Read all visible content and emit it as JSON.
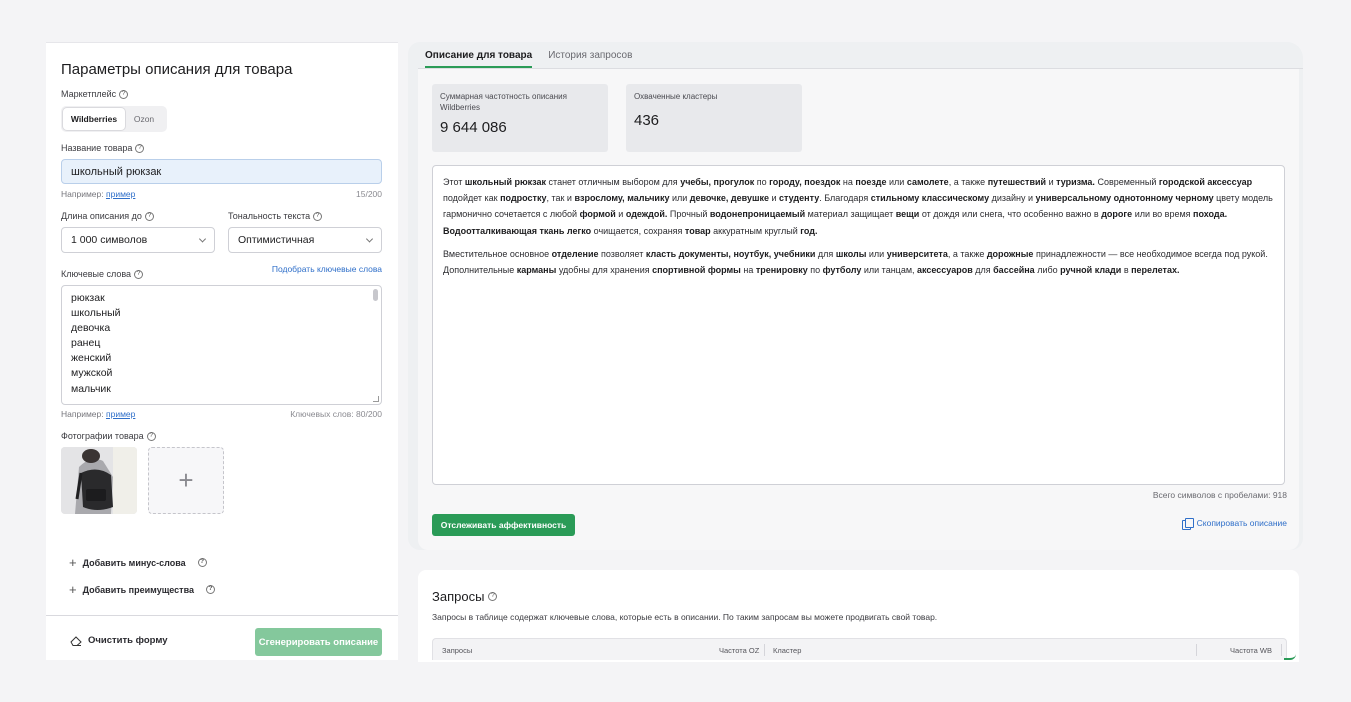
{
  "left": {
    "title": "Параметры описания для товара",
    "marketplace_label": "Маркетплейс",
    "marketplaces": [
      "Wildberries",
      "Ozon"
    ],
    "product_name_label": "Название товара",
    "product_name_value": "школьный рюкзак",
    "hint_prefix": "Например:",
    "hint_link": "пример",
    "product_name_counter": "15/200",
    "length_label": "Длина описания до",
    "length_value": "1 000 символов",
    "tone_label": "Тональность текста",
    "tone_value": "Оптимистичная",
    "keywords_label": "Ключевые слова",
    "pick_keywords": "Подобрать ключевые слова",
    "keywords": [
      "рюкзак",
      "школьный",
      "девочка",
      "ранец",
      "женский",
      "мужской",
      "мальчик"
    ],
    "keywords_counter": "Ключевых слов: 80/200",
    "photos_label": "Фотографии товара",
    "add_minus_words": "Добавить минус-слова",
    "add_advantages": "Добавить преимущества",
    "clear_form": "Очистить форму",
    "generate": "Сгенерировать описание"
  },
  "right": {
    "tabs": [
      "Описание для товара",
      "История запросов"
    ],
    "stats": [
      {
        "label": "Суммарная частотность описания Wildberries",
        "value": "9 644 086"
      },
      {
        "label": "Охваченные кластеры",
        "value": "436"
      }
    ],
    "total_chars": "Всего символов с пробелами: 918",
    "track_button": "Отслеживать аффективность",
    "copy_link": "Скопировать описание"
  },
  "queries": {
    "title": "Запросы",
    "subtitle": "Запросы в таблице содержат ключевые слова, которые есть в описании. По таким запросам вы можете продвигать свой товар.",
    "columns": [
      "Запросы",
      "Частота OZ",
      "Кластер",
      "Частота WB"
    ]
  },
  "colors": {
    "accent_green": "#2a9b57",
    "link_blue": "#2f6fc9",
    "disabled_green": "#84c89c"
  },
  "icons": [
    "question-icon",
    "chevron-down-icon",
    "plus-icon",
    "eraser-icon",
    "copy-icon"
  ]
}
